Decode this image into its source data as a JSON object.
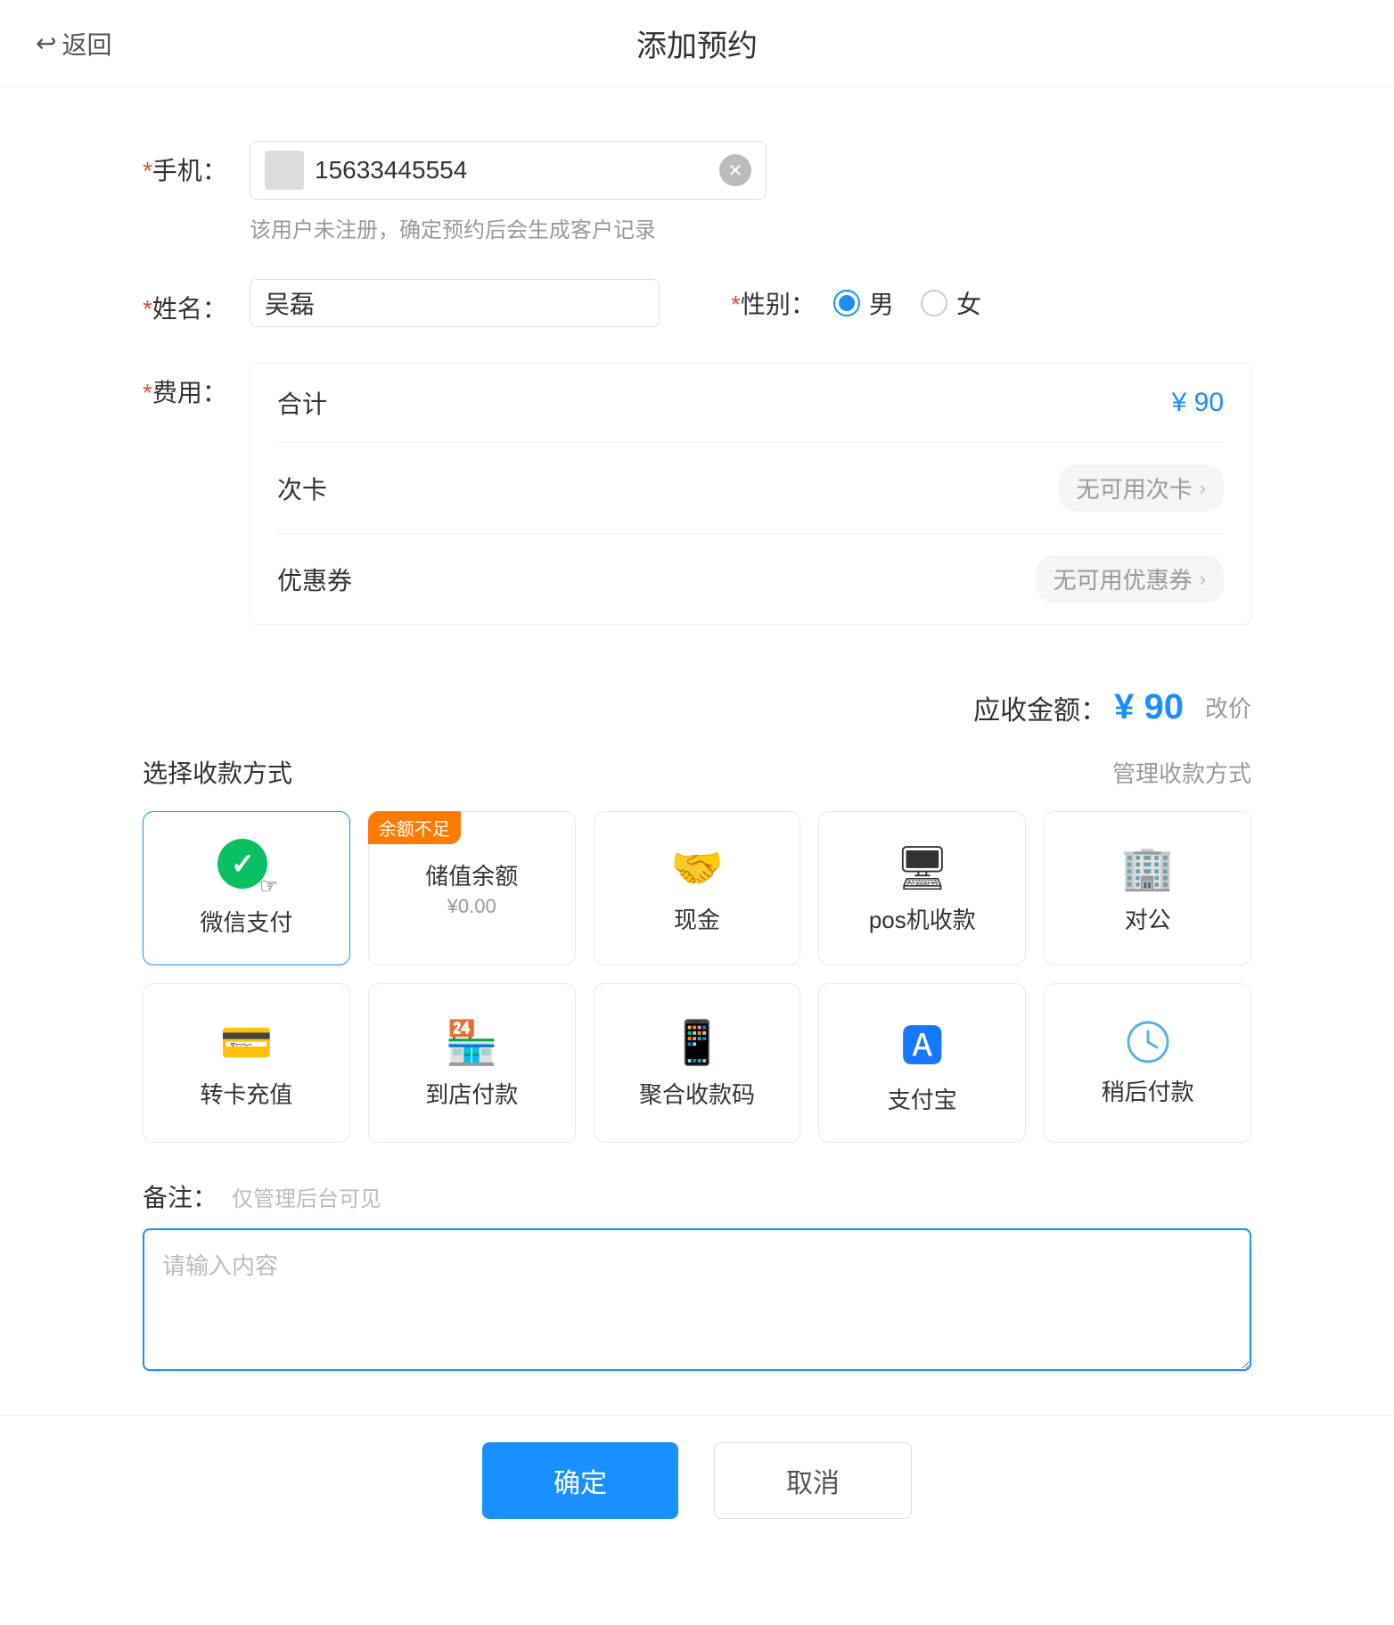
{
  "header": {
    "back_label": "返回",
    "title": "添加预约"
  },
  "form": {
    "phone_label": "手机：",
    "phone_required": "*",
    "phone_value": "15633445554",
    "phone_hint": "该用户未注册，确定预约后会生成客户记录",
    "name_label": "姓名：",
    "name_required": "*",
    "name_value": "吴磊",
    "gender_label": "*性别：",
    "gender_male": "男",
    "gender_female": "女",
    "gender_selected": "male",
    "fee_label": "费用：",
    "fee_required": "*",
    "fee_total_label": "合计",
    "fee_total_amount": "¥ 90",
    "fee_card_label": "次卡",
    "fee_card_value": "无可用次卡",
    "fee_coupon_label": "优惠券",
    "fee_coupon_value": "无可用优惠券",
    "receivable_label": "应收金额：",
    "receivable_amount": "¥ 90",
    "change_price_label": "改价"
  },
  "payment": {
    "title": "选择收款方式",
    "manage_label": "管理收款方式",
    "methods": [
      {
        "id": "wechat",
        "label": "微信支付",
        "icon_type": "wechat",
        "selected": true,
        "badge": null
      },
      {
        "id": "balance",
        "label": "储值余额\n¥0.00",
        "label_main": "储值余额",
        "label_sub": "¥0.00",
        "icon_type": "balance",
        "selected": false,
        "badge": "余额不足"
      },
      {
        "id": "cash",
        "label": "现金",
        "icon_type": "cash",
        "selected": false,
        "badge": null
      },
      {
        "id": "pos",
        "label": "pos机收款",
        "icon_type": "pos",
        "selected": false,
        "badge": null
      },
      {
        "id": "corporate",
        "label": "对公",
        "icon_type": "corporate",
        "selected": false,
        "badge": null
      },
      {
        "id": "transfer",
        "label": "转卡充值",
        "icon_type": "transfer",
        "selected": false,
        "badge": null
      },
      {
        "id": "instore",
        "label": "到店付款",
        "icon_type": "instore",
        "selected": false,
        "badge": null
      },
      {
        "id": "aggregate",
        "label": "聚合收款码",
        "icon_type": "aggregate",
        "selected": false,
        "badge": null
      },
      {
        "id": "alipay",
        "label": "支付宝",
        "icon_type": "alipay",
        "selected": false,
        "badge": null
      },
      {
        "id": "later",
        "label": "稍后付款",
        "icon_type": "later",
        "selected": false,
        "badge": null
      }
    ]
  },
  "remark": {
    "label": "备注：",
    "hint": "仅管理后台可见",
    "placeholder": "请输入内容"
  },
  "buttons": {
    "confirm": "确定",
    "cancel": "取消"
  }
}
